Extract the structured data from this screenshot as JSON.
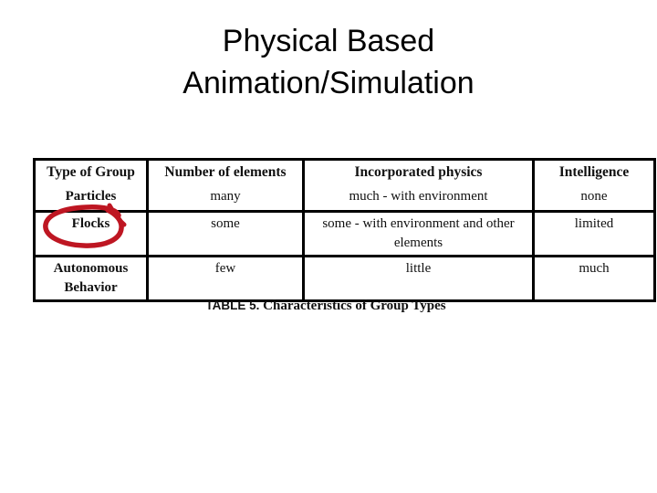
{
  "slide": {
    "title_line1": "Physical Based",
    "title_line2": "Animation/Simulation"
  },
  "table": {
    "caption_number": "TABLE 5.",
    "caption_text": " Characteristics of Group Types",
    "headers": [
      "Type of Group",
      "Number of elements",
      "Incorporated physics",
      "Intelligence"
    ],
    "rows": [
      {
        "type_of_group": "Particles",
        "number_of_elements": "many",
        "incorporated_physics": "much - with environment",
        "intelligence": "none"
      },
      {
        "type_of_group": "Flocks",
        "number_of_elements": "some",
        "incorporated_physics": "some - with environment and other elements",
        "intelligence": "limited"
      },
      {
        "type_of_group": "Autonomous Behavior",
        "number_of_elements": "few",
        "incorporated_physics": "little",
        "intelligence": "much"
      }
    ]
  },
  "annotation": {
    "shape": "hand-drawn-ellipse",
    "target": "Flocks",
    "color": "#BE1622"
  }
}
